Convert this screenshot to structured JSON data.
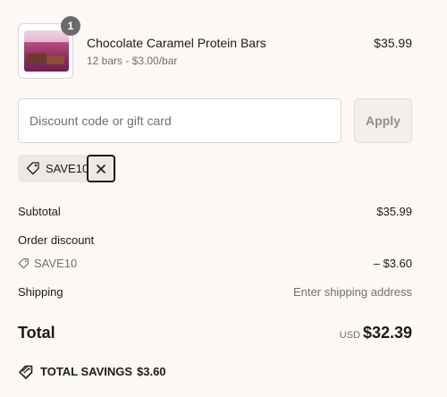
{
  "line_item": {
    "quantity": "1",
    "name": "Chocolate Caramel Protein Bars",
    "variant": "12 bars - $3.00/bar",
    "price": "$35.99"
  },
  "discount": {
    "placeholder": "Discount code or gift card",
    "value": "",
    "apply_label": "Apply",
    "applied_code": "SAVE10",
    "remove_icon": "close-icon"
  },
  "summary": {
    "subtotal_label": "Subtotal",
    "subtotal_value": "$35.99",
    "order_discount_label": "Order discount",
    "discount_code": "SAVE10",
    "discount_value": "– $3.60",
    "shipping_label": "Shipping",
    "shipping_value": "Enter shipping address",
    "total_label": "Total",
    "total_currency": "USD",
    "total_value": "$32.39",
    "savings_label": "TOTAL SAVINGS",
    "savings_value": "$3.60"
  },
  "colors": {
    "background": "#fcf8f6",
    "text": "#1b1b1b",
    "muted": "#707070",
    "tag_background": "#efe7e3"
  }
}
